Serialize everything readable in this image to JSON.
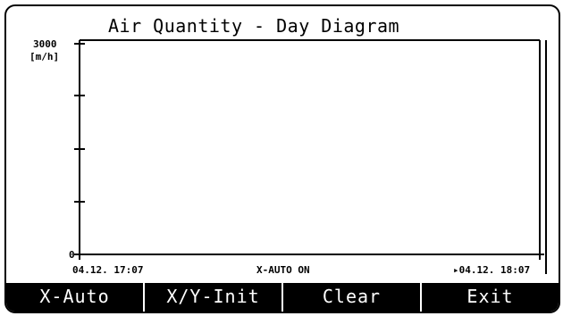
{
  "diagram": {
    "title": "Air Quantity - Day Diagram",
    "y_axis": {
      "max_label": "3000",
      "min_label": "0",
      "unit": "[m/h]"
    },
    "x_axis": {
      "start_label": "04.12. 17:07",
      "end_label": "▸04.12. 18:07"
    },
    "status": "X-AUTO ON"
  },
  "chart_data": {
    "type": "line",
    "title": "Air Quantity - Day Diagram",
    "ylabel": "[m/h]",
    "ylim": [
      0,
      3000
    ],
    "x_range": [
      "04.12. 17:07",
      "04.12. 18:07"
    ],
    "series": []
  },
  "softkeys": [
    {
      "label": "X-Auto"
    },
    {
      "label": "X/Y-Init"
    },
    {
      "label": "Clear"
    },
    {
      "label": "Exit"
    }
  ]
}
